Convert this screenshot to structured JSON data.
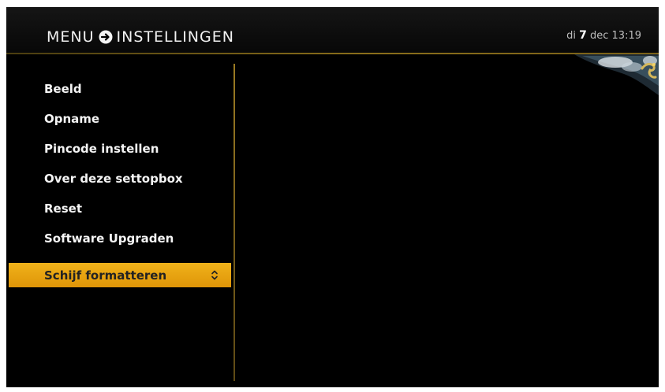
{
  "header": {
    "menu_label": "MENU",
    "section_label": "INSTELLINGEN",
    "datetime": {
      "weekday": "di",
      "day": "7",
      "month": "dec",
      "time": "13:19"
    }
  },
  "menu": {
    "items": [
      {
        "label": "Beeld"
      },
      {
        "label": "Opname"
      },
      {
        "label": "Pincode instellen"
      },
      {
        "label": "Over deze settopbox"
      },
      {
        "label": "Reset"
      },
      {
        "label": "Software Upgraden"
      },
      {
        "label": "Schijf formatteren",
        "selected": true
      }
    ],
    "selected_index": 6
  },
  "colors": {
    "background": "#000000",
    "highlight": "#f0a810",
    "accent_line": "#8a6e1a",
    "text": "#f4f4f4"
  },
  "icons": {
    "breadcrumb_separator": "arrow-right-circle-icon",
    "selected_item_indicator": "up-down-arrows-icon"
  }
}
